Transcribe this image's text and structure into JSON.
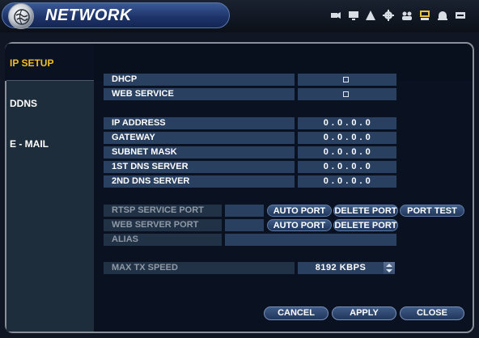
{
  "header": {
    "title": "NETWORK",
    "icons": [
      "camera-icon",
      "display-icon",
      "record-icon",
      "settings-icon",
      "users-icon",
      "network-icon",
      "alarm-icon",
      "storage-icon"
    ]
  },
  "tabs": [
    {
      "label": "IP SETUP",
      "active": true
    },
    {
      "label": "DDNS",
      "active": false
    },
    {
      "label": "E - MAIL",
      "active": false
    }
  ],
  "form": {
    "dhcp": {
      "label": "DHCP",
      "checked": false
    },
    "web_service": {
      "label": "WEB SERVICE",
      "checked": false
    },
    "ip_address": {
      "label": "IP ADDRESS",
      "value": "0 . 0 . 0 . 0"
    },
    "gateway": {
      "label": "GATEWAY",
      "value": "0 . 0 . 0 . 0"
    },
    "subnet_mask": {
      "label": "SUBNET MASK",
      "value": "0 . 0 . 0 . 0"
    },
    "dns1": {
      "label": "1ST DNS SERVER",
      "value": "0 . 0 . 0 . 0"
    },
    "dns2": {
      "label": "2ND DNS SERVER",
      "value": "0 . 0 . 0 . 0"
    },
    "rtsp_port": {
      "label": "RTSP SERVICE PORT",
      "auto": "AUTO PORT",
      "delete": "DELETE PORT",
      "test": "PORT TEST"
    },
    "web_port": {
      "label": "WEB SERVER PORT",
      "auto": "AUTO PORT",
      "delete": "DELETE PORT"
    },
    "alias": {
      "label": "ALIAS",
      "value": ""
    },
    "max_tx": {
      "label": "MAX TX SPEED",
      "value": "8192 KBPS"
    }
  },
  "buttons": {
    "cancel": "CANCEL",
    "apply": "APPLY",
    "close": "CLOSE"
  },
  "colors": {
    "active_tab": "#f0c020",
    "field": "#2a4060",
    "panel": "#0a1222"
  }
}
